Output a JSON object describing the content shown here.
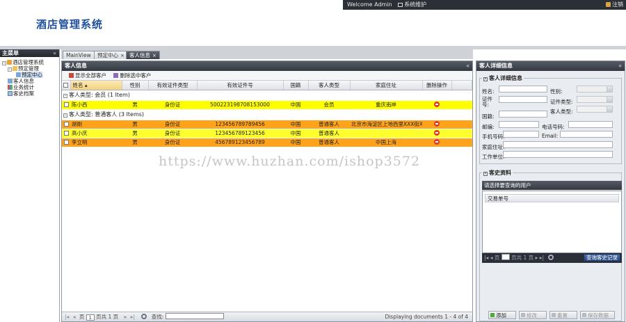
{
  "topbar": {
    "welcome": "Welcome Admin",
    "sys_maint": "系统维护",
    "logout": "注销"
  },
  "app_title": "酒店管理系统",
  "left_panel": {
    "title": "主菜单",
    "tree": [
      {
        "label": "酒店管理系统",
        "level": 0,
        "icon": "home-icon"
      },
      {
        "label": "预定管理",
        "level": 1,
        "icon": "folder-icon"
      },
      {
        "label": "预定中心",
        "level": 2,
        "icon": "page-icon",
        "selected": true
      },
      {
        "label": "客人信息",
        "level": 1,
        "icon": "page-icon"
      },
      {
        "label": "业务统计",
        "level": 1,
        "icon": "chart-icon"
      },
      {
        "label": "客史档案",
        "level": 1,
        "icon": "doc-icon"
      }
    ]
  },
  "tabs": [
    {
      "label": "MainView",
      "closable": false
    },
    {
      "label": "预定中心",
      "closable": true
    },
    {
      "label": "客人信息",
      "closable": true,
      "active": true
    }
  ],
  "grid": {
    "title": "客人信息",
    "toolbar": {
      "show_all": "显示全部客户",
      "delete_selected": "删除选中客户"
    },
    "columns": [
      "姓名",
      "性别",
      "有效证件类型",
      "有效证件号",
      "国籍",
      "客人类型",
      "家庭住址",
      "删除操作"
    ],
    "groups": [
      {
        "label": "客人类型: 会员 (1 Item)",
        "rows": [
          {
            "name": "陈小西",
            "gender": "男",
            "id_type": "身份证",
            "id_no": "500223198708153000",
            "country": "中国",
            "type": "会员",
            "address": "重庆南岸"
          }
        ]
      },
      {
        "label": "客人类型: 普通客人 (3 Items)",
        "rows": [
          {
            "name": "胡刚",
            "gender": "男",
            "id_type": "身份证",
            "id_no": "123456789789456",
            "country": "中国",
            "type": "普通客人",
            "address": "北京市海淀区上地西里XXX街X单..."
          },
          {
            "name": "高小庆",
            "gender": "男",
            "id_type": "身份证",
            "id_no": "123456789123456",
            "country": "中国",
            "type": "普通客人",
            "address": ""
          },
          {
            "name": "李立明",
            "gender": "男",
            "id_type": "身份证",
            "id_no": "456789123456789",
            "country": "中国",
            "type": "普通客人",
            "address": "中国上海"
          }
        ]
      }
    ],
    "pager": {
      "page_prefix": "页",
      "page": "1",
      "page_total": "页共 1 页",
      "search_label": "查找:",
      "display": "Displaying documents 1 - 4 of 4"
    }
  },
  "watermark": "https://www.huzhan.com/ishop3572",
  "right_panel": {
    "title": "客人详细信息",
    "detail_legend": "客人详细信息",
    "fields": {
      "name": "姓名:",
      "gender": "性别:",
      "id_no": "证件号:",
      "id_type": "证件类型:",
      "guest_type": "客人类型:",
      "country": "国籍:",
      "zip": "邮编:",
      "phone": "电话号码:",
      "mobile": "手机号码:",
      "email": "Email:",
      "home_addr": "家庭住址:",
      "work_unit": "工作单位:"
    },
    "history_legend": "客史资料",
    "history_head": "请选择要查询的用户",
    "history_col": "交易单号",
    "history_pager": {
      "page_prefix": "页",
      "page": "1",
      "page_total": "页共 1 页",
      "query_btn": "查询客史记录"
    }
  },
  "actions": {
    "add": "添加",
    "edit": "修改",
    "reset": "重置",
    "save": "保存数据"
  }
}
